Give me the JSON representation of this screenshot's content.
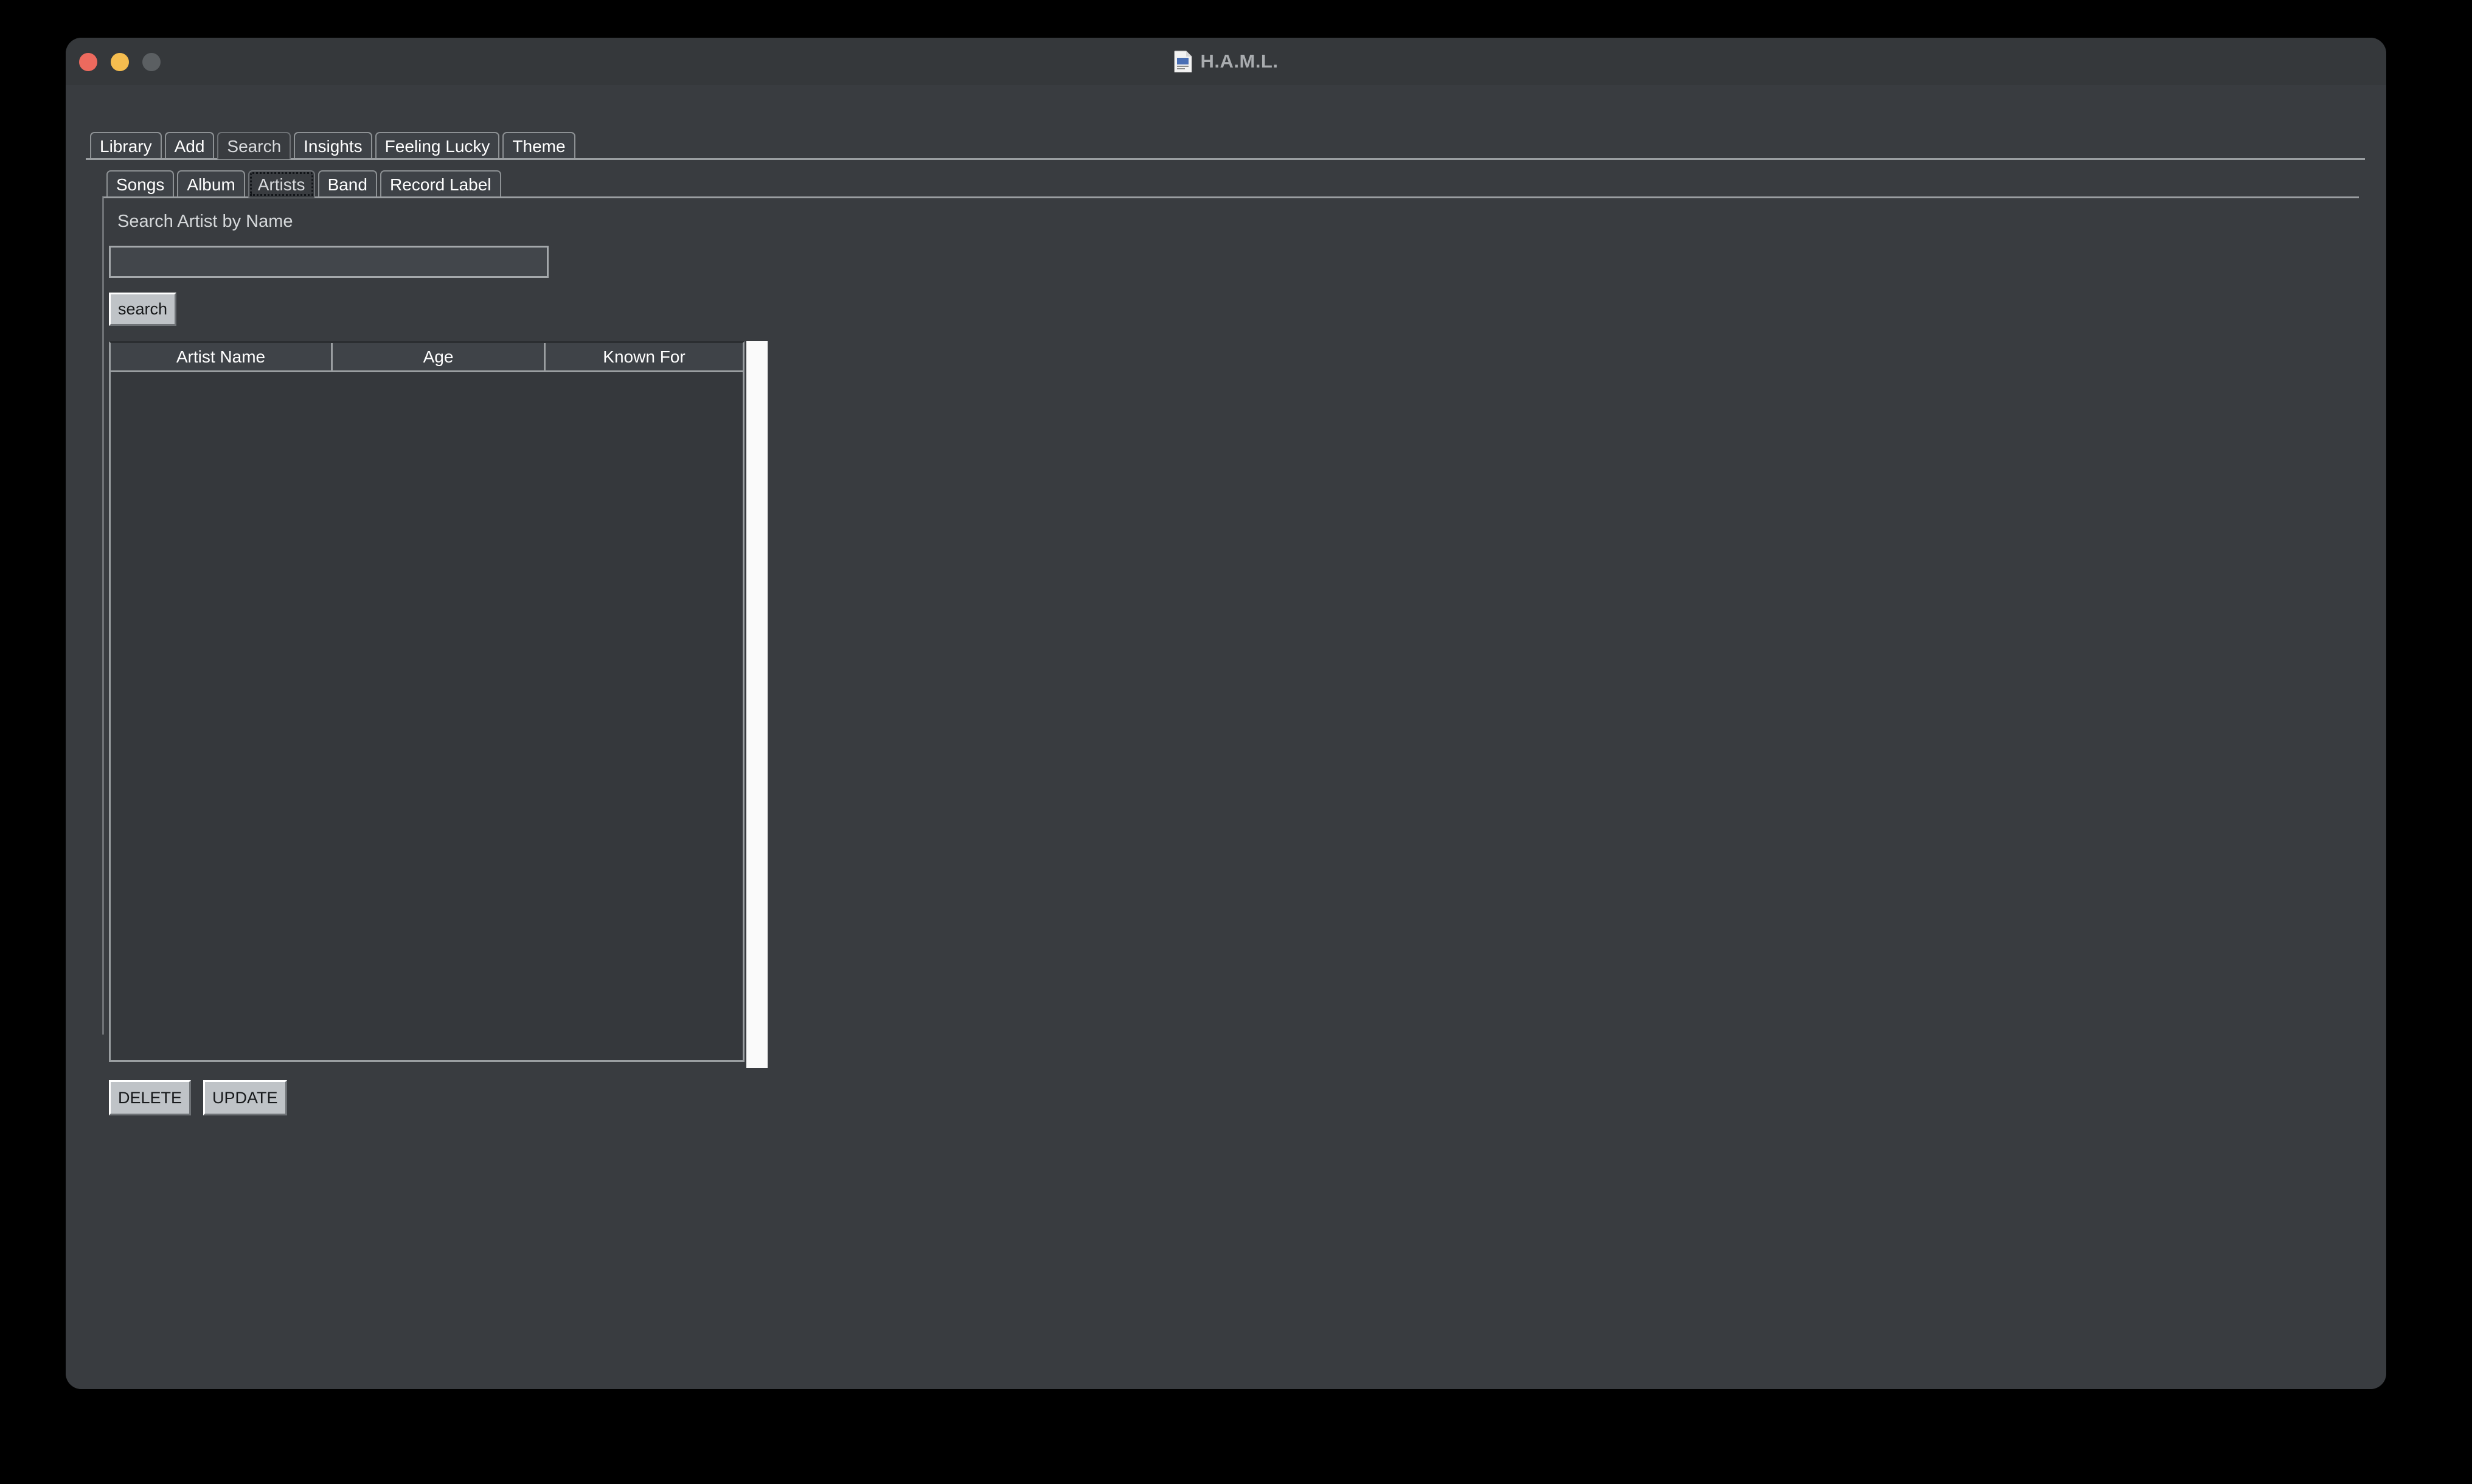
{
  "window": {
    "title": "H.A.M.L.",
    "icon": "document-icon",
    "traffic_lights": [
      {
        "name": "close",
        "color": "#ed6a5e"
      },
      {
        "name": "minimize",
        "color": "#f5bd4f"
      },
      {
        "name": "zoom",
        "color": "#5b5f62"
      }
    ],
    "background": "#393c40",
    "titlebar_background": "#35383b",
    "title_color": "#a9acaf"
  },
  "outer_tabs": {
    "items": [
      {
        "label": "Library",
        "active": false
      },
      {
        "label": "Add",
        "active": false
      },
      {
        "label": "Search",
        "active": true
      },
      {
        "label": "Insights",
        "active": false
      },
      {
        "label": "Feeling Lucky",
        "active": false
      },
      {
        "label": "Theme",
        "active": false
      }
    ]
  },
  "inner_tabs": {
    "items": [
      {
        "label": "Songs",
        "active": false
      },
      {
        "label": "Album",
        "active": false
      },
      {
        "label": "Artists",
        "active": true,
        "focused": true
      },
      {
        "label": "Band",
        "active": false
      },
      {
        "label": "Record Label",
        "active": false
      }
    ]
  },
  "search_form": {
    "label": "Search Artist by Name",
    "input_value": "",
    "input_placeholder": "",
    "button_label": "search"
  },
  "results_table": {
    "columns": [
      "Artist Name",
      "Age",
      "Known For"
    ],
    "rows": [],
    "scrollbar_color": "#fafafa"
  },
  "actions": {
    "delete_label": "DELETE",
    "update_label": "UPDATE",
    "button_face": "#bfc3c7",
    "button_text": "#17191b"
  }
}
